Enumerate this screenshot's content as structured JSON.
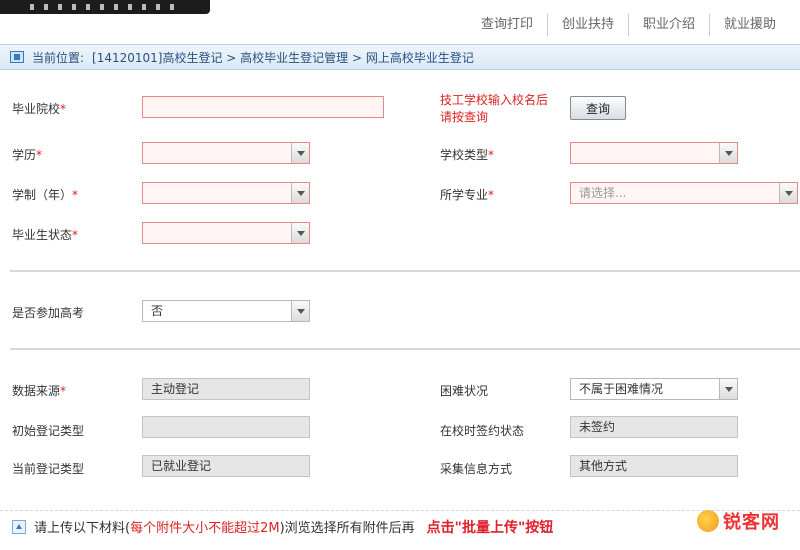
{
  "header": {
    "nav": [
      "查询打印",
      "创业扶持",
      "职业介绍",
      "就业援助"
    ]
  },
  "breadcrumb": {
    "prefix": "当前位置:",
    "path": "[14120101]高校生登记 > 高校毕业生登记管理 > 网上高校毕业生登记"
  },
  "form": {
    "school_label": "毕业院校",
    "school_hint": "技工学校输入校名后请按查询",
    "query_button": "查询",
    "education_label": "学历",
    "school_type_label": "学校类型",
    "duration_label": "学制（年）",
    "major_label": "所学专业",
    "major_placeholder": "请选择...",
    "grad_status_label": "毕业生状态",
    "gaokao_label": "是否参加高考",
    "gaokao_value": "否",
    "source_label": "数据来源",
    "source_value": "主动登记",
    "difficulty_label": "困难状况",
    "difficulty_value": "不属于困难情况",
    "initial_type_label": "初始登记类型",
    "initial_type_value": "",
    "contract_label": "在校时签约状态",
    "contract_value": "未签约",
    "current_type_label": "当前登记类型",
    "current_type_value": "已就业登记",
    "collect_label": "采集信息方式",
    "collect_value": "其他方式"
  },
  "upload": {
    "text_a": "请上传以下材料(",
    "text_red": "每个附件大小不能超过2M",
    "text_b": ")浏览选择所有附件后再",
    "text_action": "点击\"批量上传\"按钮"
  },
  "watermark": "锐客网",
  "colors": {
    "required_red": "#d22222",
    "breadcrumb_blue": "#2a5080",
    "required_field_border": "#e08a8a"
  }
}
